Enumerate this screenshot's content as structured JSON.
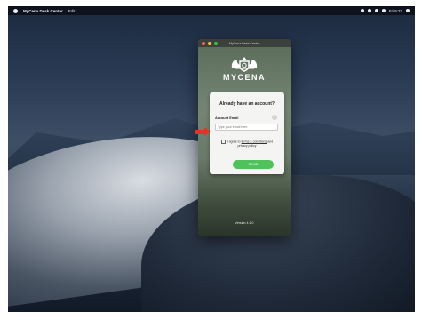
{
  "menubar": {
    "app_name": "MyCena Desk Center",
    "menu_item": "Edit",
    "clock": "Fri 9:32"
  },
  "window": {
    "title": "MyCena Desk Center",
    "brand": "MYCENA",
    "card": {
      "heading": "Already have an account?",
      "email_label": "Account Email",
      "email_placeholder": "Type your email here",
      "info_icon": "info-icon",
      "agree_prefix": "I agree to",
      "terms_link": "terms & conditions",
      "agree_middle": "and",
      "privacy_link": "privacy policy",
      "send_label": "SEND"
    },
    "version": "Version 4.1.0"
  },
  "colors": {
    "send_button": "#4fc25c",
    "annotation_arrow": "#e53228"
  }
}
